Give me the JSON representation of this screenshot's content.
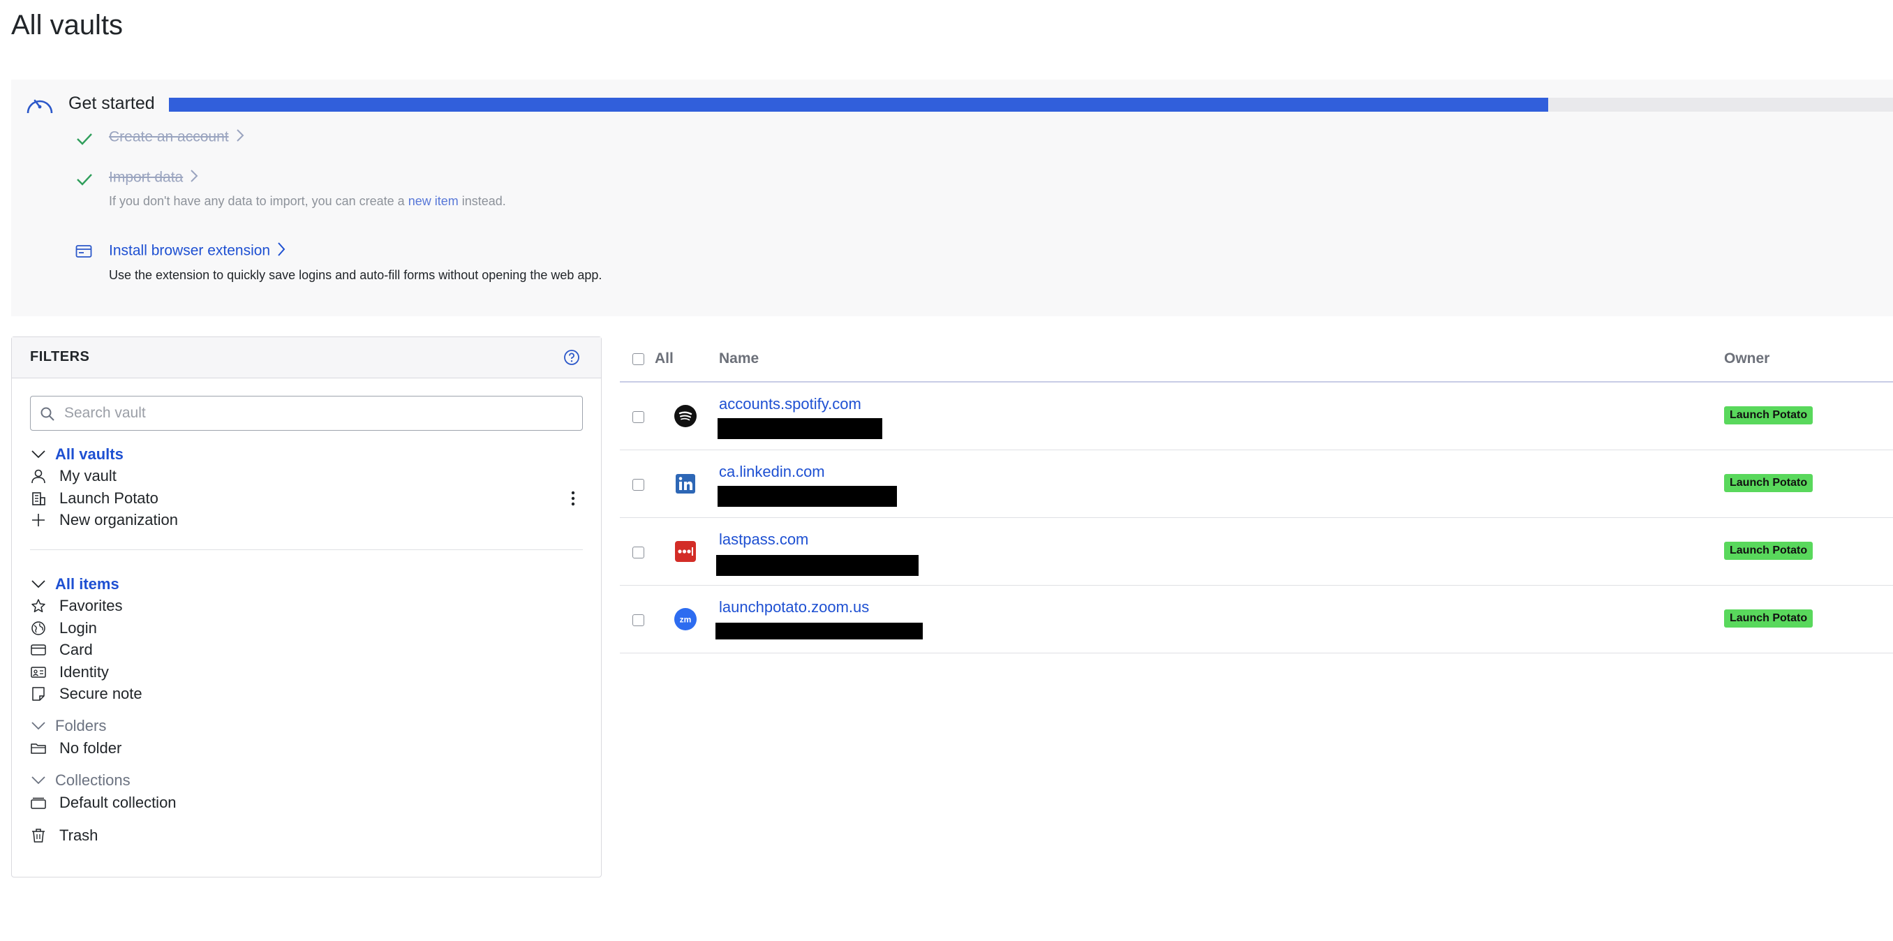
{
  "page": {
    "title": "All vaults"
  },
  "onboarding": {
    "title": "Get started",
    "progress_percent": 80,
    "accent_color": "#315fdb",
    "tasks": [
      {
        "label": "Create an account",
        "done": true
      },
      {
        "label": "Import data",
        "done": true,
        "desc_before": "If you don't have any data to import, you can create a",
        "desc_link": "new item",
        "desc_after": "instead."
      },
      {
        "label": "Install browser extension",
        "done": false,
        "desc": "Use the extension to quickly save logins and auto-fill forms without opening the web app."
      }
    ]
  },
  "filters": {
    "title": "FILTERS",
    "search_placeholder": "Search vault",
    "vaults_header": "All vaults",
    "vaults": [
      "My vault",
      "Launch Potato",
      "New organization"
    ],
    "items_header": "All items",
    "types": [
      "Favorites",
      "Login",
      "Card",
      "Identity",
      "Secure note"
    ],
    "folders_header": "Folders",
    "folders": [
      "No folder"
    ],
    "collections_header": "Collections",
    "collections": [
      "Default collection"
    ],
    "trash": "Trash"
  },
  "table": {
    "headers": {
      "all": "All",
      "name": "Name",
      "owner": "Owner"
    },
    "rows": [
      {
        "name": "accounts.spotify.com",
        "icon": "spotify-icon",
        "owner": "Launch Potato"
      },
      {
        "name": "ca.linkedin.com",
        "icon": "linkedin-icon",
        "owner": "Launch Potato"
      },
      {
        "name": "lastpass.com",
        "icon": "lastpass-icon",
        "owner": "Launch Potato"
      },
      {
        "name": "launchpotato.zoom.us",
        "icon": "zoom-icon",
        "owner": "Launch Potato"
      }
    ],
    "badge_color": "#59d85c"
  }
}
